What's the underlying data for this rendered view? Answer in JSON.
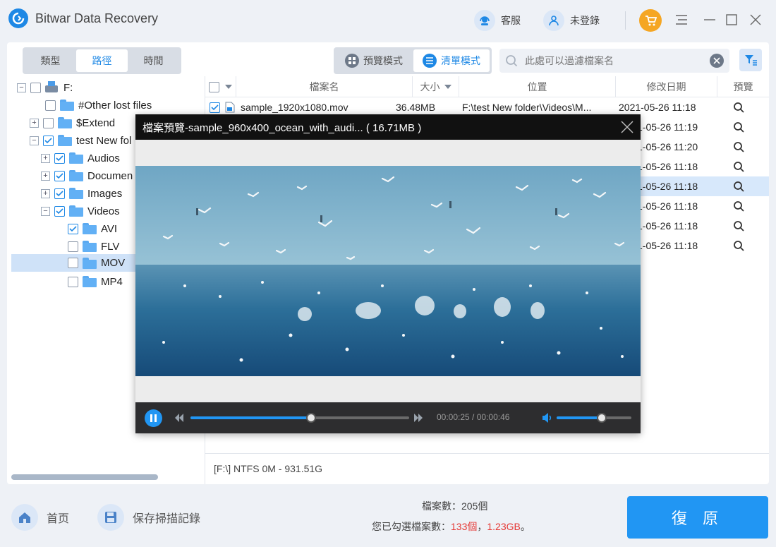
{
  "app": {
    "title": "Bitwar Data Recovery"
  },
  "titlebar": {
    "support_label": "客服",
    "login_label": "未登錄"
  },
  "view_tabs": [
    "類型",
    "路徑",
    "時間"
  ],
  "mode_tabs": {
    "preview_label": "預覽模式",
    "list_label": "清單模式"
  },
  "search": {
    "placeholder": "此處可以過濾檔案名"
  },
  "tree": {
    "drive": "F:",
    "other_lost": "#Other lost files",
    "extend": "$Extend",
    "test_folder": "test New fol",
    "audios": "Audios",
    "documents": "Documen",
    "images": "Images",
    "videos": "Videos",
    "avi": "AVI",
    "flv": "FLV",
    "mov": "MOV",
    "mp4": "MP4"
  },
  "table": {
    "headers": {
      "name": "檔案名",
      "size": "大小",
      "location": "位置",
      "modified": "修改日期",
      "preview": "預覽"
    },
    "rows": [
      {
        "name": "sample_1920x1080.mov",
        "size": "36.48MB",
        "location": "F:\\test New folder\\Videos\\M...",
        "modified": "2021-05-26  11:18"
      },
      {
        "modified": "1-05-26  11:19"
      },
      {
        "modified": "1-05-26  11:20"
      },
      {
        "modified": "1-05-26  11:18"
      },
      {
        "modified": "1-05-26  11:18"
      },
      {
        "modified": "1-05-26  11:18"
      },
      {
        "modified": "1-05-26  11:18"
      },
      {
        "modified": "1-05-26  11:18"
      }
    ]
  },
  "status": "[F:\\] NTFS 0M - 931.51G",
  "footer": {
    "home_label": "首页",
    "save_label": "保存掃描記錄",
    "file_count_label": "檔案數：205個",
    "selected_prefix": "您已勾選檔案數：",
    "selected_count": "133個",
    "selected_sep": "，",
    "selected_size": "1.23GB",
    "selected_suffix": "。",
    "recover_label": "復 原"
  },
  "preview": {
    "title": "檔案預覽-sample_960x400_ocean_with_audi... ( 16.71MB )",
    "time": "00:00:25 / 00:00:46",
    "progress": 0.55,
    "volume": 0.6
  },
  "colors": {
    "accent": "#2196f3",
    "selected_row": "#d7e8fb",
    "warning": "#e53935"
  }
}
